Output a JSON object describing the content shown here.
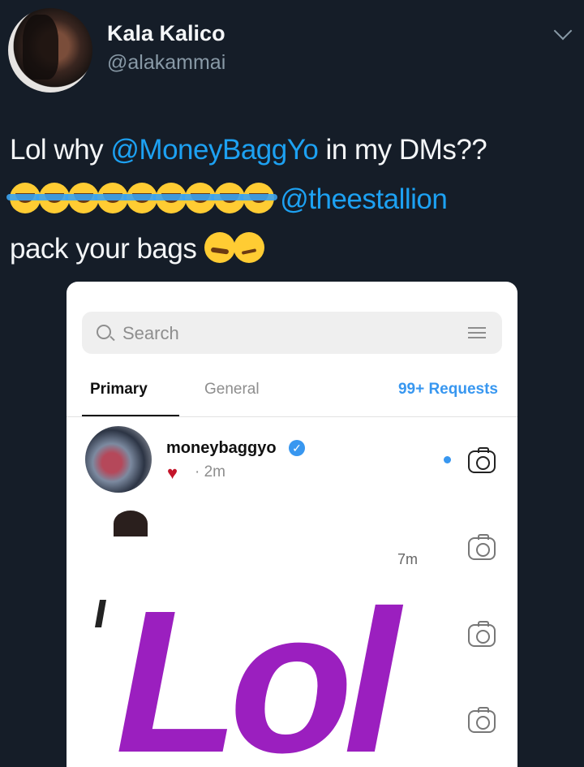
{
  "tweet": {
    "author_name": "Kala Kalico",
    "author_handle": "@alakammai",
    "text_part1": "Lol why ",
    "mention1": "@MoneyBaggYo",
    "text_part2": " in my DMs??",
    "mention2": "@theestallion",
    "text_part3": "pack your bags",
    "emojis": [
      "face-with-tears-of-joy x9",
      "woozy-face",
      "smirking-face"
    ],
    "colors": {
      "background": "#151d28",
      "mention": "#1da1f2",
      "secondary_text": "#8899a6"
    }
  },
  "embedded_screenshot": {
    "search_placeholder": "Search",
    "tabs": {
      "primary": "Primary",
      "general": "General",
      "requests": "99+ Requests"
    },
    "conversation": {
      "username": "moneybaggyo",
      "time": "· 2m",
      "verified": true
    },
    "row2_time": "7m",
    "overlay_text": "Lol",
    "colors": {
      "link": "#3897f0",
      "overlay": "#9b1fbf"
    }
  }
}
